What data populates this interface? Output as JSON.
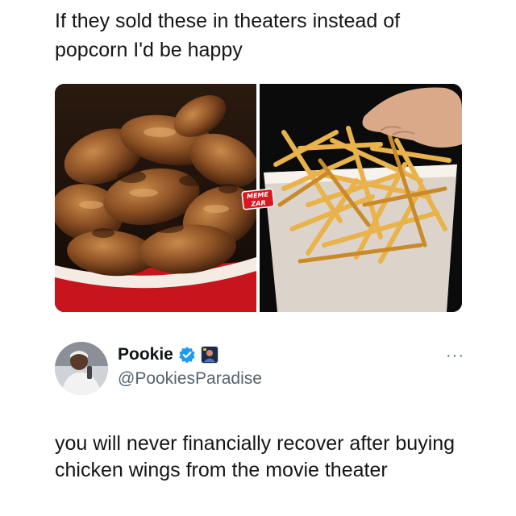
{
  "caption": "If they sold these in theaters instead of popcorn I'd be happy",
  "media": {
    "left_image": "chicken-wings-bucket",
    "right_image": "french-fries-popcorn-cup",
    "watermark_line1": "MEME",
    "watermark_line2": "ZAR"
  },
  "tweet": {
    "display_name": "Pookie",
    "handle": "@PookiesParadise",
    "verified_icon": "verified-badge-icon",
    "affiliate_icon": "affiliate-badge-icon",
    "more_label": "···",
    "text": "you will never financially recover after buying chicken wings from the movie theater"
  },
  "colors": {
    "verified": "#1d9bf0",
    "watermark": "#d6191f",
    "secondary_text": "#536471",
    "bucket_red": "#c8141c"
  }
}
